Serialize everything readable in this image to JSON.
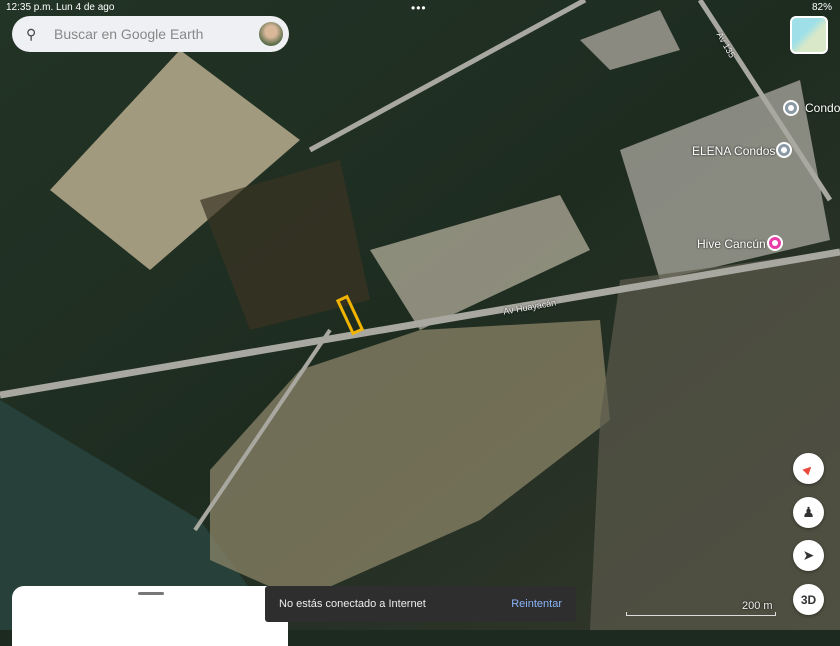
{
  "status_bar": {
    "time_date": "12:35 p.m.  Lun 4 de ago",
    "battery": "82%"
  },
  "search": {
    "placeholder": "Buscar en Google Earth"
  },
  "places": [
    {
      "label": "Condo"
    },
    {
      "label": "ELENA Condos"
    },
    {
      "label": "Hive Cancún"
    }
  ],
  "roads": [
    {
      "label": "Av 135"
    },
    {
      "label": "Av Huayacán"
    }
  ],
  "controls": {
    "three_d": "3D"
  },
  "scale": {
    "label": "200 m"
  },
  "toast": {
    "message": "No estás conectado a Internet",
    "action": "Reintentar"
  },
  "colors": {
    "accent": "#8ab4f8",
    "hotel_pin": "#e93ea8",
    "highlight": "#f0b400"
  }
}
